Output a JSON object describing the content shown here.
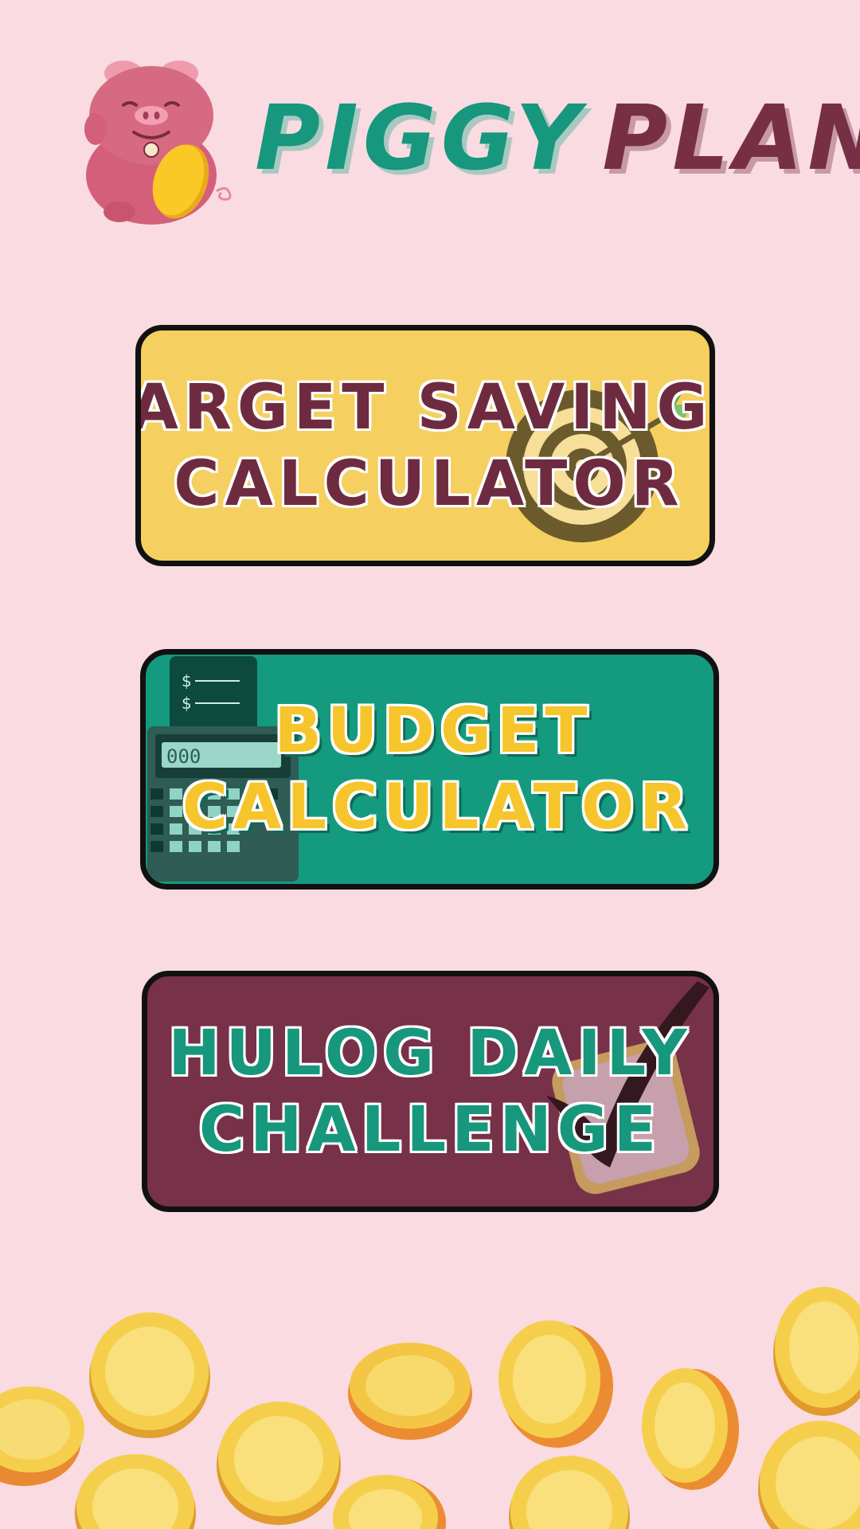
{
  "header": {
    "brand_part_1": "PIGGY",
    "brand_part_2": "PLAN"
  },
  "menu": {
    "target_savings": {
      "line_1": "TARGET SAVINGS",
      "line_2": "CALCULATOR"
    },
    "budget": {
      "line_1": "BUDGET",
      "line_2": "CALCULATOR"
    },
    "hulog": {
      "line_1": "HULOG DAILY",
      "line_2": "CHALLENGE"
    }
  },
  "colors": {
    "background": "#f9dbe1",
    "brand_green": "#16977e",
    "brand_maroon": "#772f46",
    "card_yellow": "#f5d060",
    "card_green": "#149a7f",
    "card_maroon": "#773148",
    "coin_gold": "#f5cf4c"
  },
  "icons": [
    "piggy-bank-icon",
    "target-icon",
    "calculator-icon",
    "checkmark-icon",
    "gold-coin-icon"
  ]
}
